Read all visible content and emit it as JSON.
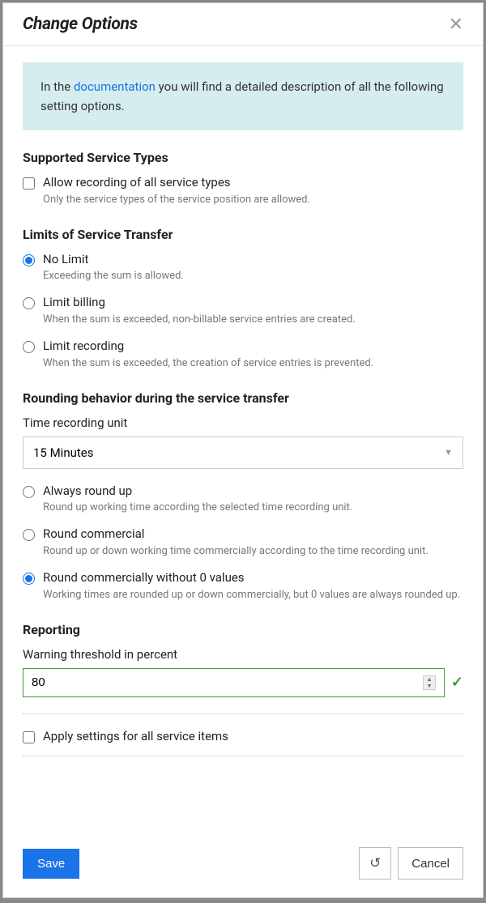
{
  "modal": {
    "title": "Change Options"
  },
  "info": {
    "prefix": "In the ",
    "link": "documentation",
    "suffix": " you will find a detailed description of all the following setting options."
  },
  "sections": {
    "supported": {
      "heading": "Supported Service Types"
    },
    "limits": {
      "heading": "Limits of Service Transfer"
    },
    "rounding": {
      "heading": "Rounding behavior during the service transfer",
      "time_label": "Time recording unit",
      "time_value": "15 Minutes"
    },
    "reporting": {
      "heading": "Reporting",
      "threshold_label": "Warning threshold in percent",
      "threshold_value": "80"
    }
  },
  "options": {
    "allow_all": {
      "label": "Allow recording of all service types",
      "desc": "Only the service types of the service position are allowed."
    },
    "no_limit": {
      "label": "No Limit",
      "desc": "Exceeding the sum is allowed."
    },
    "limit_billing": {
      "label": "Limit billing",
      "desc": "When the sum is exceeded, non-billable service entries are created."
    },
    "limit_recording": {
      "label": "Limit recording",
      "desc": "When the sum is exceeded, the creation of service entries is prevented."
    },
    "round_up": {
      "label": "Always round up",
      "desc": "Round up working time according the selected time recording unit."
    },
    "round_commercial": {
      "label": "Round commercial",
      "desc": "Round up or down working time commercially according to the time recording unit."
    },
    "round_commercial_no_zero": {
      "label": "Round commercially without 0 values",
      "desc": "Working times are rounded up or down commercially, but 0 values are always rounded up."
    },
    "apply_all": {
      "label": "Apply settings for all service items"
    }
  },
  "buttons": {
    "save": "Save",
    "cancel": "Cancel"
  }
}
